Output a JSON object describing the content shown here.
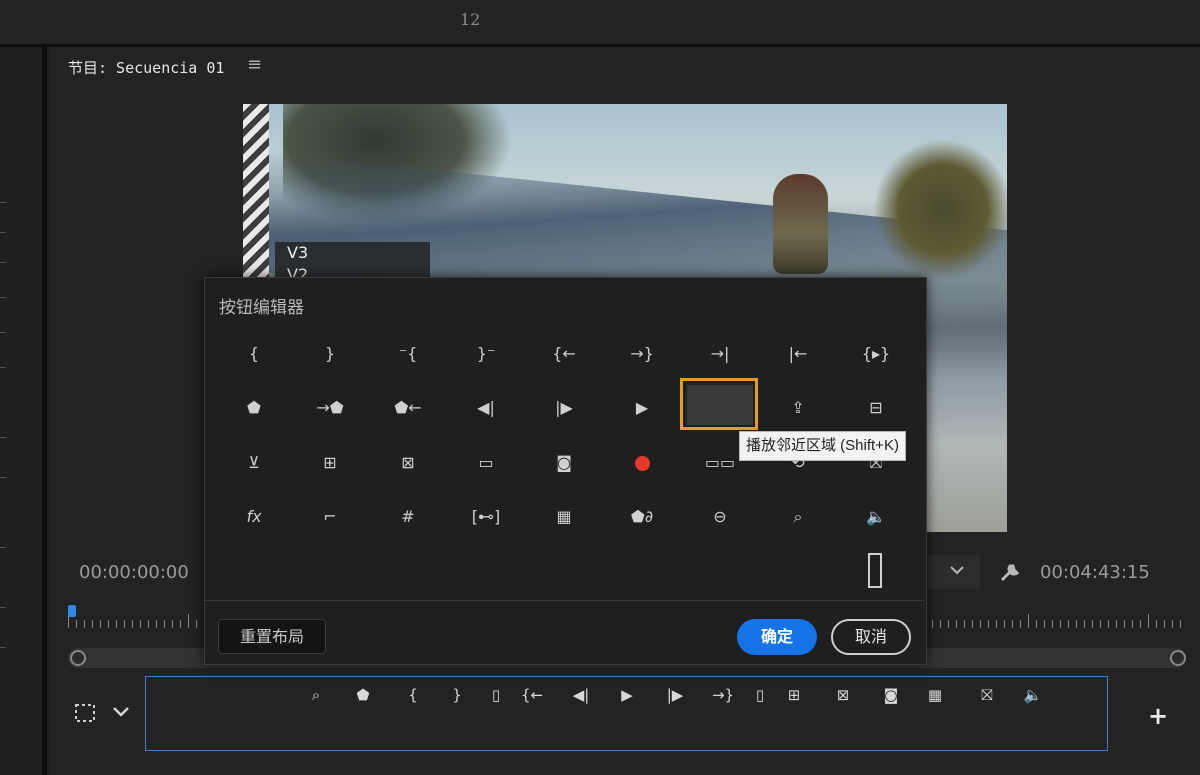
{
  "top": {
    "frame_number": "12"
  },
  "monitor": {
    "title": "节目: Secuencia 01",
    "menu_icon": "hamburger-icon",
    "tracks": [
      "V3",
      "V2"
    ],
    "timecode_in": "00:00:00:00",
    "timecode_duration": "00:04:43:15"
  },
  "dialog": {
    "title": "按钮编辑器",
    "rows": [
      [
        "{",
        "}",
        "⁻{",
        "}⁻",
        "{←",
        "→}",
        "→|",
        "|←",
        "{▸}"
      ],
      [
        "⬟",
        "→⬟",
        "⬟←",
        "◀|",
        "|▶",
        "▶",
        "▸|▸",
        "⇪",
        "⊟"
      ],
      [
        "⊻",
        "⊞",
        "⊠",
        "▭",
        "◙",
        "●",
        "▭▭",
        "⟲",
        "⛝"
      ],
      [
        "fx",
        "⌐",
        "#",
        "[⊷]",
        "▦",
        "⬟∂",
        "⊖",
        "⌕",
        "🔈"
      ]
    ],
    "tooltip": "播放邻近区域 (Shift+K)",
    "reset_label": "重置布局",
    "ok_label": "确定",
    "cancel_label": "取消",
    "accent": "#1473e6",
    "highlight": "#e69a2a"
  },
  "transport": {
    "buttons": [
      "⌕",
      "⬟",
      "{",
      "}",
      "▯",
      "{←",
      "◀|",
      "▶",
      "|▶",
      "→}",
      "▯",
      "⊞",
      "⊠",
      "◙",
      "▦",
      "⛝",
      "🔈"
    ],
    "plus": "+"
  }
}
